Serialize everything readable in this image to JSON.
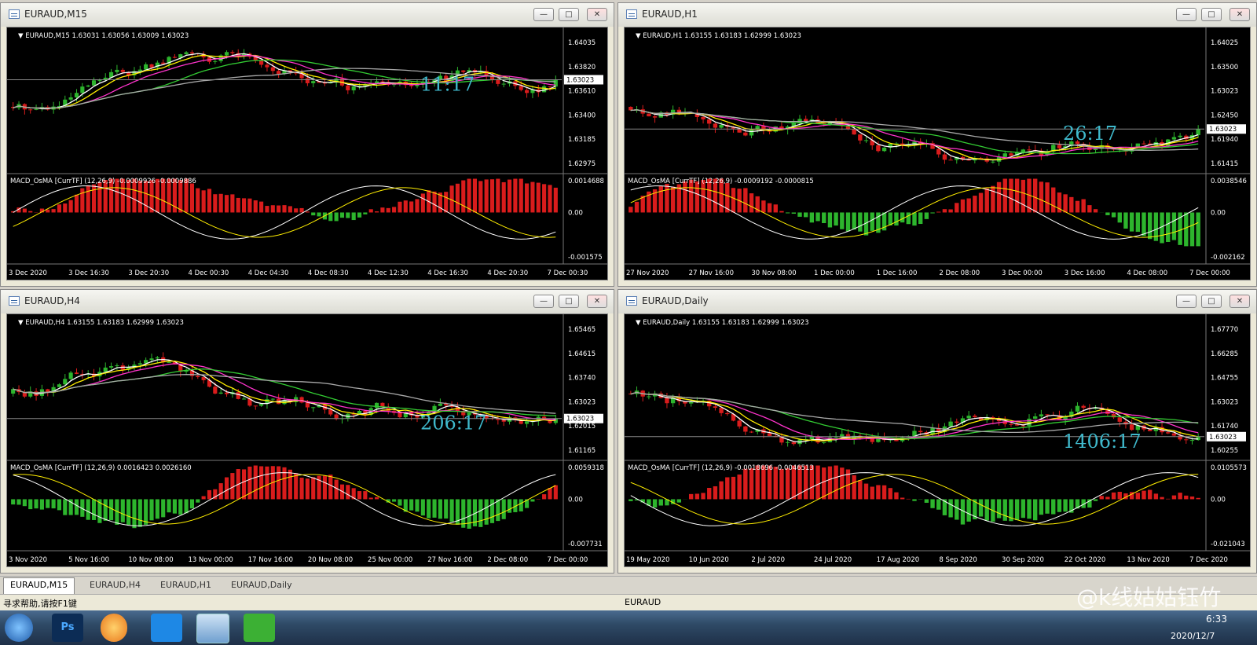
{
  "windows": [
    {
      "id": "m15",
      "title": "EURAUD,M15",
      "info": "EURAUD,M15  1.63031 1.63056 1.63009 1.63023",
      "price_ticks": [
        "1.64035",
        "1.63820",
        "1.63610",
        "1.63400",
        "1.63185",
        "1.62975"
      ],
      "current_price": "1.63023",
      "timer": "11:17",
      "macd_label": "MACD_OsMA [CurrTF] (12,26,9) -0.0009926 -0.0009886",
      "macd_ticks": [
        "0.0014688",
        "0.00",
        "-0.001575"
      ],
      "time_labels": [
        "3 Dec 2020",
        "3 Dec 16:30",
        "3 Dec 20:30",
        "4 Dec 00:30",
        "4 Dec 04:30",
        "4 Dec 08:30",
        "4 Dec 12:30",
        "4 Dec 16:30",
        "4 Dec 20:30",
        "7 Dec 00:30"
      ]
    },
    {
      "id": "h1",
      "title": "EURAUD,H1",
      "info": "EURAUD,H1  1.63155 1.63183 1.62999 1.63023",
      "price_ticks": [
        "1.64025",
        "1.63500",
        "1.63023",
        "1.62450",
        "1.61940",
        "1.61415"
      ],
      "current_price": "1.63023",
      "timer": "26:17",
      "macd_label": "MACD_OsMA [CurrTF] (12,26,9) -0.0009192 -0.0000815",
      "macd_ticks": [
        "0.0038546",
        "0.00",
        "-0.002162"
      ],
      "time_labels": [
        "27 Nov 2020",
        "27 Nov 16:00",
        "30 Nov 08:00",
        "1 Dec 00:00",
        "1 Dec 16:00",
        "2 Dec 08:00",
        "3 Dec 00:00",
        "3 Dec 16:00",
        "4 Dec 08:00",
        "7 Dec 00:00"
      ]
    },
    {
      "id": "h4",
      "title": "EURAUD,H4",
      "info": "EURAUD,H4  1.63155 1.63183 1.62999 1.63023",
      "price_ticks": [
        "1.65465",
        "1.64615",
        "1.63740",
        "1.63023",
        "1.62015",
        "1.61165"
      ],
      "current_price": "1.63023",
      "timer": "206:17",
      "macd_label": "MACD_OsMA [CurrTF] (12,26,9) 0.0016423 0.0026160",
      "macd_ticks": [
        "0.0059318",
        "0.00",
        "-0.007731"
      ],
      "time_labels": [
        "3 Nov 2020",
        "5 Nov 16:00",
        "10 Nov 08:00",
        "13 Nov 00:00",
        "17 Nov 16:00",
        "20 Nov 08:00",
        "25 Nov 00:00",
        "27 Nov 16:00",
        "2 Dec 08:00",
        "7 Dec 00:00"
      ]
    },
    {
      "id": "daily",
      "title": "EURAUD,Daily",
      "info": "EURAUD,Daily  1.63155 1.63183 1.62999 1.63023",
      "price_ticks": [
        "1.67770",
        "1.66285",
        "1.64755",
        "1.63023",
        "1.61740",
        "1.60255"
      ],
      "current_price": "1.63023",
      "timer": "1406:17",
      "macd_label": "MACD_OsMA [CurrTF] (12,26,9) -0.0018696 -0.0046513",
      "macd_ticks": [
        "0.0105573",
        "0.00",
        "-0.021043"
      ],
      "time_labels": [
        "19 May 2020",
        "10 Jun 2020",
        "2 Jul 2020",
        "24 Jul 2020",
        "17 Aug 2020",
        "8 Sep 2020",
        "30 Sep 2020",
        "22 Oct 2020",
        "13 Nov 2020",
        "7 Dec 2020"
      ]
    }
  ],
  "tabs": [
    "EURAUD,M15",
    "EURAUD,H4",
    "EURAUD,H1",
    "EURAUD,Daily"
  ],
  "status": {
    "help": "寻求帮助,请按F1键",
    "symbol": "EURAUD"
  },
  "watermark": "@k线姑姑钰竹",
  "taskbar": {
    "clock": "6:33",
    "date": "2020/12/7"
  },
  "colors": {
    "bull": "#2db52d",
    "bear": "#d91c1c",
    "ma_white": "#ffffff",
    "ma_yellow": "#ffee00",
    "ma_magenta": "#ff33cc",
    "ma_green": "#33cc33",
    "ma_gray": "#a9a9a9",
    "timer": "#3fb9cc"
  },
  "icons": [
    "windows-start-icon",
    "photoshop-icon",
    "browser-icon",
    "app-icon",
    "terminal-icon",
    "wechat-icon"
  ]
}
